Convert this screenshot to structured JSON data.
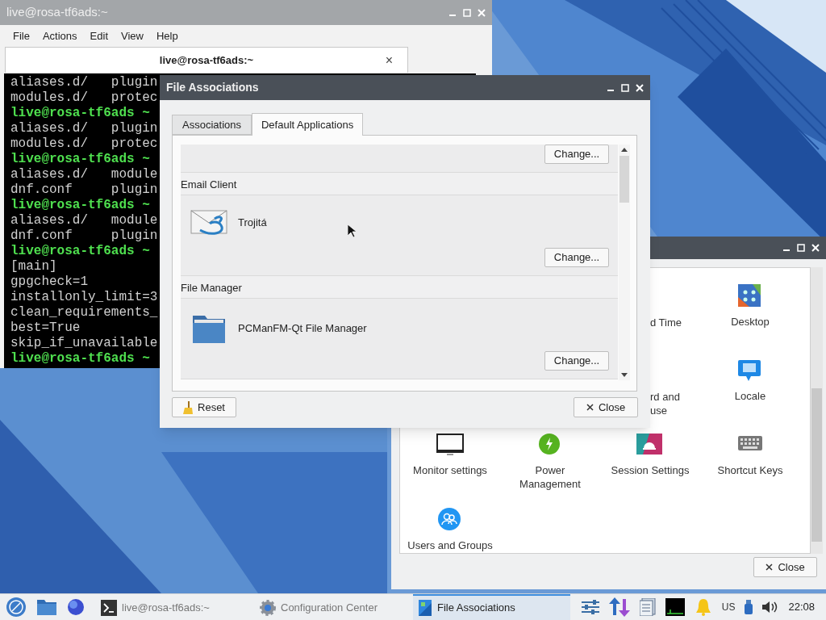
{
  "terminal": {
    "title": "live@rosa-tf6ads:~",
    "menu": [
      "File",
      "Actions",
      "Edit",
      "View",
      "Help"
    ],
    "tab": {
      "label": "live@rosa-tf6ads:~",
      "close": "×"
    },
    "lines": [
      {
        "kind": "output",
        "text": "aliases.d/   plugin"
      },
      {
        "kind": "output",
        "text": "modules.d/   protec"
      },
      {
        "kind": "prompt",
        "text": "live@rosa-tf6ads ~"
      },
      {
        "kind": "output",
        "text": "aliases.d/   plugin"
      },
      {
        "kind": "output",
        "text": "modules.d/   protec"
      },
      {
        "kind": "prompt",
        "text": "live@rosa-tf6ads ~"
      },
      {
        "kind": "output",
        "text": "aliases.d/   module"
      },
      {
        "kind": "output",
        "text": "dnf.conf     plugin"
      },
      {
        "kind": "prompt",
        "text": "live@rosa-tf6ads ~"
      },
      {
        "kind": "output",
        "text": "aliases.d/   module"
      },
      {
        "kind": "output",
        "text": "dnf.conf     plugin"
      },
      {
        "kind": "prompt",
        "text": "live@rosa-tf6ads ~"
      },
      {
        "kind": "output",
        "text": "[main]"
      },
      {
        "kind": "output",
        "text": "gpgcheck=1"
      },
      {
        "kind": "output",
        "text": "installonly_limit=3"
      },
      {
        "kind": "output",
        "text": "clean_requirements_"
      },
      {
        "kind": "output",
        "text": "best=True"
      },
      {
        "kind": "output",
        "text": "skip_if_unavailable"
      },
      {
        "kind": "prompt",
        "text": "live@rosa-tf6ads ~"
      }
    ]
  },
  "config_center": {
    "items": [
      {
        "kind": "covered",
        "label": "d Time"
      },
      {
        "kind": "desktop",
        "label": "Desktop"
      },
      {
        "kind": "covered",
        "label": "rd and use"
      },
      {
        "kind": "locale",
        "label": "Locale"
      },
      {
        "kind": "monitor",
        "label": "Monitor settings"
      },
      {
        "kind": "power",
        "label": "Power Management"
      },
      {
        "kind": "session",
        "label": "Session Settings"
      },
      {
        "kind": "keyboard",
        "label": "Shortcut Keys"
      },
      {
        "kind": "users",
        "label": "Users and Groups"
      }
    ],
    "close_button": "Close"
  },
  "dialog": {
    "title": "File Associations",
    "tabs": [
      {
        "label": "Associations",
        "selected": false
      },
      {
        "label": "Default Applications",
        "selected": true
      }
    ],
    "sections": [
      {
        "kind": "partial",
        "button": "Change..."
      },
      {
        "kind": "mail",
        "heading": "Email Client",
        "app": "Trojitá",
        "button": "Change..."
      },
      {
        "kind": "folder",
        "heading": "File Manager",
        "app": "PCManFM-Qt File Manager",
        "button": "Change..."
      }
    ],
    "reset_button": "Reset",
    "close_button": "Close"
  },
  "taskbar": {
    "tasks": [
      {
        "kind": "terminal",
        "label": "live@rosa-tf6ads:~",
        "selected": false
      },
      {
        "kind": "gear",
        "label": "Configuration Center",
        "selected": false
      },
      {
        "kind": "assoc",
        "label": "File Associations",
        "selected": true
      }
    ],
    "keyboard_layout": "US",
    "clock": "22:08"
  }
}
